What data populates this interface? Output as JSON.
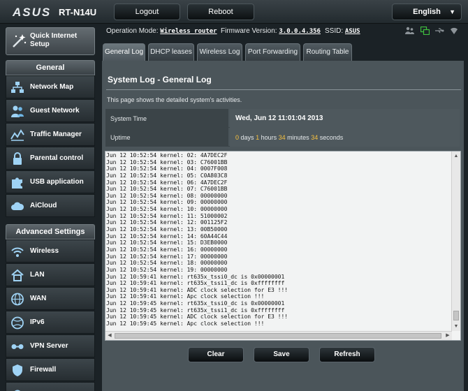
{
  "brand": {
    "logo": "ASUS",
    "model": "RT-N14U"
  },
  "top_buttons": {
    "logout": "Logout",
    "reboot": "Reboot",
    "language": "English"
  },
  "sidebar": {
    "quick_setup": "Quick Internet Setup",
    "general_header": "General",
    "general_items": [
      {
        "label": "Network Map",
        "icon": "network-map-icon"
      },
      {
        "label": "Guest Network",
        "icon": "guest-network-icon"
      },
      {
        "label": "Traffic Manager",
        "icon": "traffic-manager-icon"
      },
      {
        "label": "Parental control",
        "icon": "parental-control-icon"
      },
      {
        "label": "USB application",
        "icon": "usb-application-icon"
      },
      {
        "label": "AiCloud",
        "icon": "aicloud-icon"
      }
    ],
    "advanced_header": "Advanced Settings",
    "advanced_items": [
      {
        "label": "Wireless",
        "icon": "wireless-icon"
      },
      {
        "label": "LAN",
        "icon": "lan-icon"
      },
      {
        "label": "WAN",
        "icon": "wan-icon"
      },
      {
        "label": "IPv6",
        "icon": "ipv6-icon"
      },
      {
        "label": "VPN Server",
        "icon": "vpn-server-icon"
      },
      {
        "label": "Firewall",
        "icon": "firewall-icon"
      }
    ]
  },
  "info": {
    "op_mode_label": "Operation Mode:",
    "op_mode_value": "Wireless router",
    "firmware_label": "Firmware Version:",
    "firmware_value": "3.0.0.4.356",
    "ssid_label": "SSID:",
    "ssid_value": "ASUS"
  },
  "tabs": [
    "General Log",
    "DHCP leases",
    "Wireless Log",
    "Port Forwarding",
    "Routing Table"
  ],
  "page": {
    "title": "System Log - General Log",
    "description": "This page shows the detailed system's activities.",
    "system_time_label": "System Time",
    "system_time_value": "Wed, Jun 12 11:01:04 2013",
    "uptime_label": "Uptime",
    "uptime_days": "0",
    "uptime_days_unit": "days",
    "uptime_hours": "1",
    "uptime_hours_unit": "hours",
    "uptime_minutes": "34",
    "uptime_minutes_unit": "minutes",
    "uptime_seconds": "34",
    "uptime_seconds_unit": "seconds"
  },
  "log_lines": [
    "Jun 12 10:52:54 kernel: 02: 4A7DEC2F",
    "Jun 12 10:52:54 kernel: 03: C76001BB",
    "Jun 12 10:52:54 kernel: 04: 0007F008",
    "Jun 12 10:52:54 kernel: 05: C0A803C8",
    "Jun 12 10:52:54 kernel: 06: 4A7DEC2F",
    "Jun 12 10:52:54 kernel: 07: C76001BB",
    "Jun 12 10:52:54 kernel: 08: 00000000",
    "Jun 12 10:52:54 kernel: 09: 00000000",
    "Jun 12 10:52:54 kernel: 10: 00000000",
    "Jun 12 10:52:54 kernel: 11: 51000002",
    "Jun 12 10:52:54 kernel: 12: 001125F2",
    "Jun 12 10:52:54 kernel: 13: 00B50000",
    "Jun 12 10:52:54 kernel: 14: 60A44C44",
    "Jun 12 10:52:54 kernel: 15: D3EB0000",
    "Jun 12 10:52:54 kernel: 16: 00000000",
    "Jun 12 10:52:54 kernel: 17: 00000000",
    "Jun 12 10:52:54 kernel: 18: 00000000",
    "Jun 12 10:52:54 kernel: 19: 00000000",
    "Jun 12 10:59:41 kernel: rt635x_tssi0_dc is 0x00000001",
    "Jun 12 10:59:41 kernel: rt635x_tssi1_dc is 0xffffffff",
    "Jun 12 10:59:41 kernel: ADC clock selection for E3 !!!",
    "Jun 12 10:59:41 kernel: Apc clock selection !!!",
    "Jun 12 10:59:45 kernel: rt635x_tssi0_dc is 0x00000001",
    "Jun 12 10:59:45 kernel: rt635x_tssi1_dc is 0xffffffff",
    "Jun 12 10:59:45 kernel: ADC clock selection for E3 !!!",
    "Jun 12 10:59:45 kernel: Apc clock selection !!!"
  ],
  "actions": {
    "clear": "Clear",
    "save": "Save",
    "refresh": "Refresh"
  },
  "colors": {
    "accent_highlight": "#f7c13f",
    "panel_bg": "#4b555a",
    "page_bg": "#1b2226"
  }
}
